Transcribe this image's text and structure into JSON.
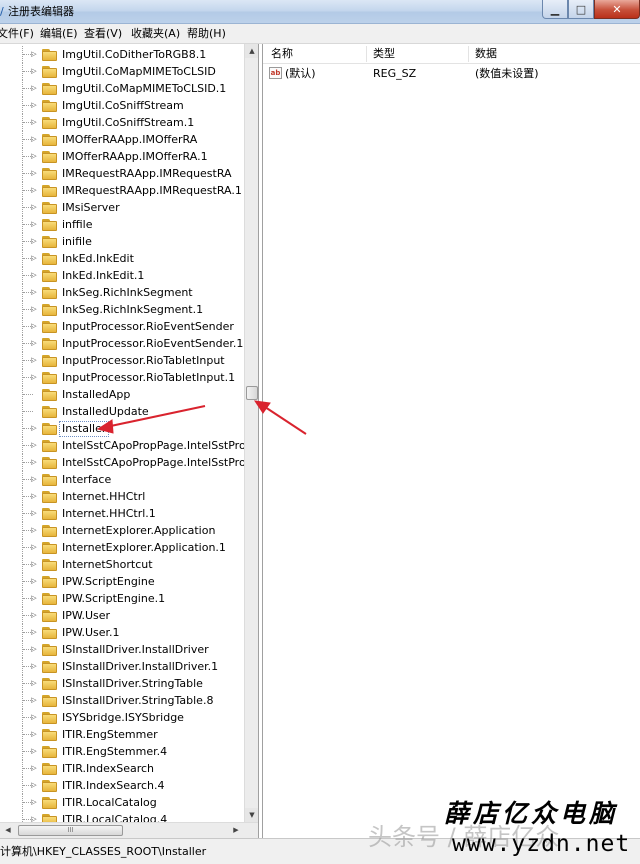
{
  "window": {
    "title": "注册表编辑器",
    "app_icon_glyph": "/",
    "buttons": {
      "minimize": "▁",
      "maximize": "□",
      "close": "✕"
    }
  },
  "menu": [
    "文件(F)",
    "编辑(E)",
    "查看(V)",
    "收藏夹(A)",
    "帮助(H)"
  ],
  "tree": {
    "selected": "Installer",
    "items": [
      {
        "label": "ImgUtil.CoDitherToRGB8.1",
        "expandable": true
      },
      {
        "label": "ImgUtil.CoMapMIMEToCLSID",
        "expandable": true
      },
      {
        "label": "ImgUtil.CoMapMIMEToCLSID.1",
        "expandable": true
      },
      {
        "label": "ImgUtil.CoSniffStream",
        "expandable": true
      },
      {
        "label": "ImgUtil.CoSniffStream.1",
        "expandable": true
      },
      {
        "label": "IMOfferRAApp.IMOfferRA",
        "expandable": true
      },
      {
        "label": "IMOfferRAApp.IMOfferRA.1",
        "expandable": true
      },
      {
        "label": "IMRequestRAApp.IMRequestRA",
        "expandable": true
      },
      {
        "label": "IMRequestRAApp.IMRequestRA.1",
        "expandable": true
      },
      {
        "label": "IMsiServer",
        "expandable": true
      },
      {
        "label": "inffile",
        "expandable": true
      },
      {
        "label": "inifile",
        "expandable": true
      },
      {
        "label": "InkEd.InkEdit",
        "expandable": true
      },
      {
        "label": "InkEd.InkEdit.1",
        "expandable": true
      },
      {
        "label": "InkSeg.RichInkSegment",
        "expandable": true
      },
      {
        "label": "InkSeg.RichInkSegment.1",
        "expandable": true
      },
      {
        "label": "InputProcessor.RioEventSender",
        "expandable": true
      },
      {
        "label": "InputProcessor.RioEventSender.1",
        "expandable": true
      },
      {
        "label": "InputProcessor.RioTabletInput",
        "expandable": true
      },
      {
        "label": "InputProcessor.RioTabletInput.1",
        "expandable": true
      },
      {
        "label": "InstalledApp",
        "expandable": false
      },
      {
        "label": "InstalledUpdate",
        "expandable": false
      },
      {
        "label": "Installer",
        "expandable": true
      },
      {
        "label": "IntelSstCApoPropPage.IntelSstPropPa",
        "expandable": true
      },
      {
        "label": "IntelSstCApoPropPage.IntelSstPropPa",
        "expandable": true
      },
      {
        "label": "Interface",
        "expandable": true
      },
      {
        "label": "Internet.HHCtrl",
        "expandable": true
      },
      {
        "label": "Internet.HHCtrl.1",
        "expandable": true
      },
      {
        "label": "InternetExplorer.Application",
        "expandable": true
      },
      {
        "label": "InternetExplorer.Application.1",
        "expandable": true
      },
      {
        "label": "InternetShortcut",
        "expandable": true
      },
      {
        "label": "IPW.ScriptEngine",
        "expandable": true
      },
      {
        "label": "IPW.ScriptEngine.1",
        "expandable": true
      },
      {
        "label": "IPW.User",
        "expandable": true
      },
      {
        "label": "IPW.User.1",
        "expandable": true
      },
      {
        "label": "ISInstallDriver.InstallDriver",
        "expandable": true
      },
      {
        "label": "ISInstallDriver.InstallDriver.1",
        "expandable": true
      },
      {
        "label": "ISInstallDriver.StringTable",
        "expandable": true
      },
      {
        "label": "ISInstallDriver.StringTable.8",
        "expandable": true
      },
      {
        "label": "ISYSbridge.ISYSbridge",
        "expandable": true
      },
      {
        "label": "ITIR.EngStemmer",
        "expandable": true
      },
      {
        "label": "ITIR.EngStemmer.4",
        "expandable": true
      },
      {
        "label": "ITIR.IndexSearch",
        "expandable": true
      },
      {
        "label": "ITIR.IndexSearch.4",
        "expandable": true
      },
      {
        "label": "ITIR.LocalCatalog",
        "expandable": true
      },
      {
        "label": "ITIR.LocalCatalog.4",
        "expandable": true
      }
    ]
  },
  "scrollbars": {
    "up": "▲",
    "down": "▼",
    "left": "◀",
    "right": "▶",
    "grip": "III"
  },
  "list": {
    "columns": [
      "名称",
      "类型",
      "数据"
    ],
    "rows": [
      {
        "icon": "ab",
        "name": "(默认)",
        "type": "REG_SZ",
        "data": "(数值未设置)"
      }
    ]
  },
  "status_bar": {
    "path": "计算机\\HKEY_CLASSES_ROOT\\Installer"
  },
  "watermark": {
    "ghost_text": "头条号 / 薛店亿众",
    "brand_cn": "薛店亿众电脑",
    "url": "www.yzdn.net"
  },
  "annotation_color": "#d9232e"
}
